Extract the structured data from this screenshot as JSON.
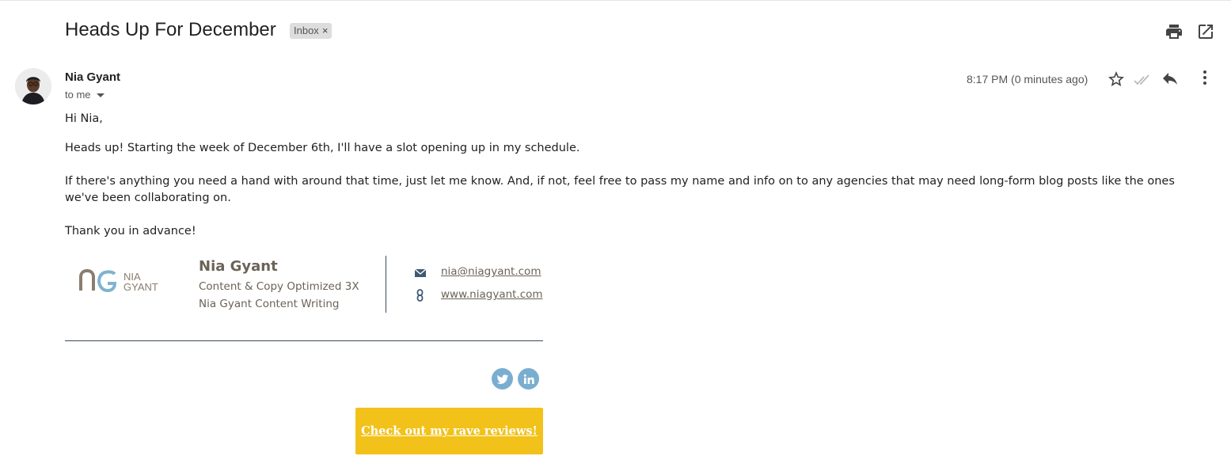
{
  "email": {
    "subject": "Heads Up For December",
    "label": "Inbox",
    "label_remove": "×",
    "sender_name": "Nia Gyant",
    "recipient": "to me",
    "timestamp": "8:17 PM (0 minutes ago)"
  },
  "toolbar_icons": [
    "print-icon",
    "open-in-new-window-icon",
    "star-icon",
    "read-check-icon",
    "reply-icon",
    "more-vert-icon"
  ],
  "body": {
    "greeting": "Hi Nia,",
    "paragraph1": "Heads up! Starting the week of December 6th, I'll have a slot opening up in my schedule.",
    "paragraph2": "If there's anything you need a hand with around that time, just let me know. And, if not, feel free to pass my name and info on to any agencies that may need long-form blog posts like the ones we've been collaborating on.",
    "closing": "Thank you in advance!"
  },
  "signature": {
    "logo_text_1": "NIA",
    "logo_text_2": "GYANT",
    "name": "Nia Gyant",
    "line1": "Content & Copy Optimized 3X",
    "line2": "Nia Gyant Content Writing",
    "email": "nia@niagyant.com",
    "website": "www.niagyant.com",
    "social": [
      "twitter-icon",
      "linkedin-icon"
    ],
    "cta": "Check out my rave reviews!"
  },
  "colors": {
    "accent_yellow": "#f2c21a",
    "social_blue": "#7aaed0",
    "signature_text": "#6b6358",
    "divider": "#3c4a5a"
  }
}
